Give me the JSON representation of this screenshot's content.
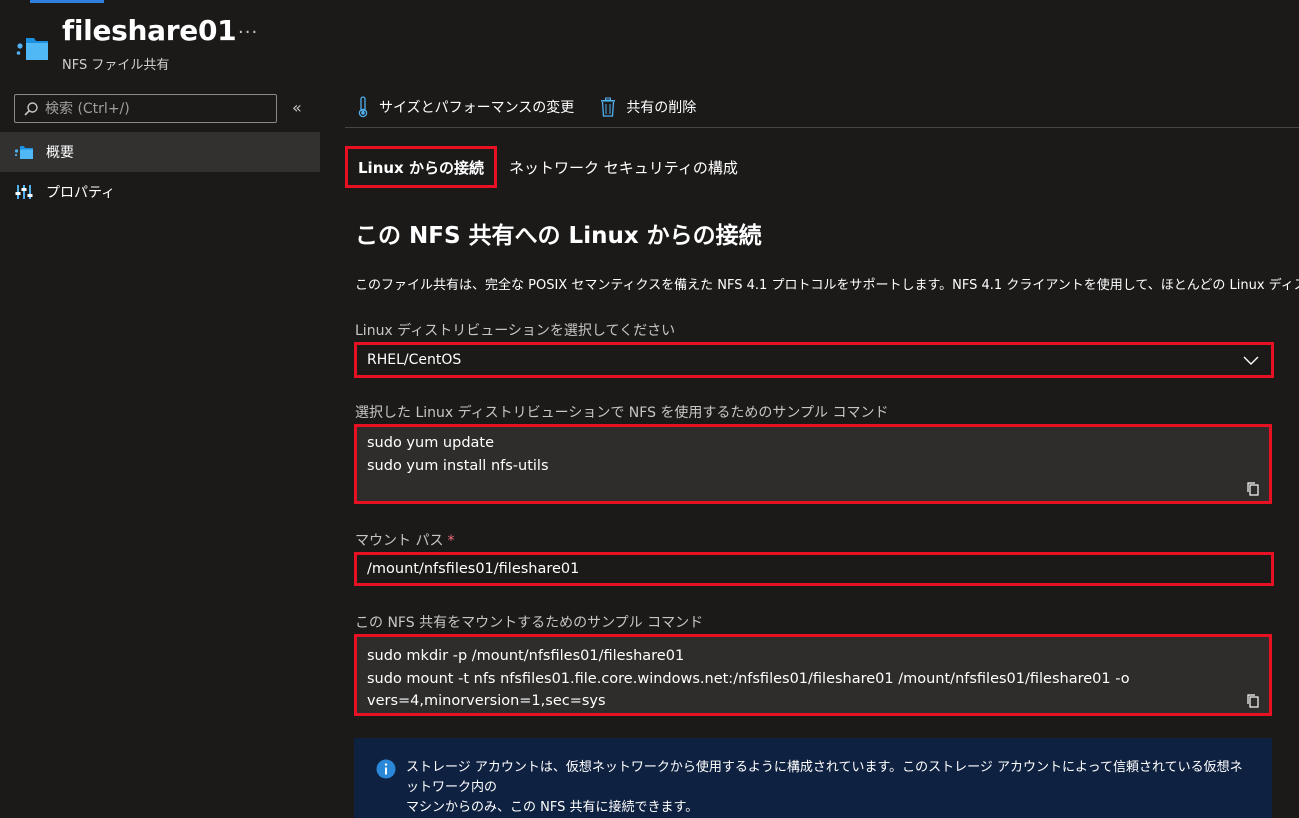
{
  "header": {
    "title": "fileshare01",
    "subtitle": "NFS ファイル共有",
    "more_label": "···"
  },
  "sidebar": {
    "search_placeholder": "検索 (Ctrl+/)",
    "collapse_label": "«",
    "items": [
      {
        "label": "概要",
        "icon": "fileshare-icon",
        "active": true
      },
      {
        "label": "プロパティ",
        "icon": "properties-icon",
        "active": false
      }
    ]
  },
  "toolbar": {
    "resize_label": "サイズとパフォーマンスの変更",
    "delete_label": "共有の削除"
  },
  "tabs": [
    {
      "label": "Linux からの接続",
      "active": true
    },
    {
      "label": "ネットワーク セキュリティの構成",
      "active": false
    }
  ],
  "main": {
    "section_title": "この NFS 共有への Linux からの接続",
    "description": "このファイル共有は、完全な POSIX セマンティクスを備えた NFS 4.1 プロトコルをサポートします。NFS 4.1 クライアントを使用して、ほとんどの Linux ディストリビューションからこの共有をマウントできます。",
    "distro_label": "Linux ディストリビューションを選択してください",
    "distro_value": "RHEL/CentOS",
    "sample_label": "選択した Linux ディストリビューションで NFS を使用するためのサンプル コマンド",
    "sample_lines": [
      "sudo yum update",
      "sudo yum install nfs-utils"
    ],
    "mount_label": "マウント パス",
    "mount_required": "*",
    "mount_value": "/mount/nfsfiles01/fileshare01",
    "mount_cmd_label": "この NFS 共有をマウントするためのサンプル コマンド",
    "mount_cmd_lines": [
      "sudo mkdir -p /mount/nfsfiles01/fileshare01",
      "sudo mount -t nfs nfsfiles01.file.core.windows.net:/nfsfiles01/fileshare01 /mount/nfsfiles01/fileshare01 -o",
      "vers=4,minorversion=1,sec=sys"
    ],
    "info_line1": "ストレージ アカウントは、仮想ネットワークから使用するように構成されています。このストレージ アカウントによって信頼されている仮想ネットワーク内の",
    "info_line2": "マシンからのみ、この NFS 共有に接続できます。"
  },
  "colors": {
    "background": "#1b1a19",
    "highlight": "#e81123",
    "info_background": "#0f2140",
    "accent": "#50b0f0"
  }
}
